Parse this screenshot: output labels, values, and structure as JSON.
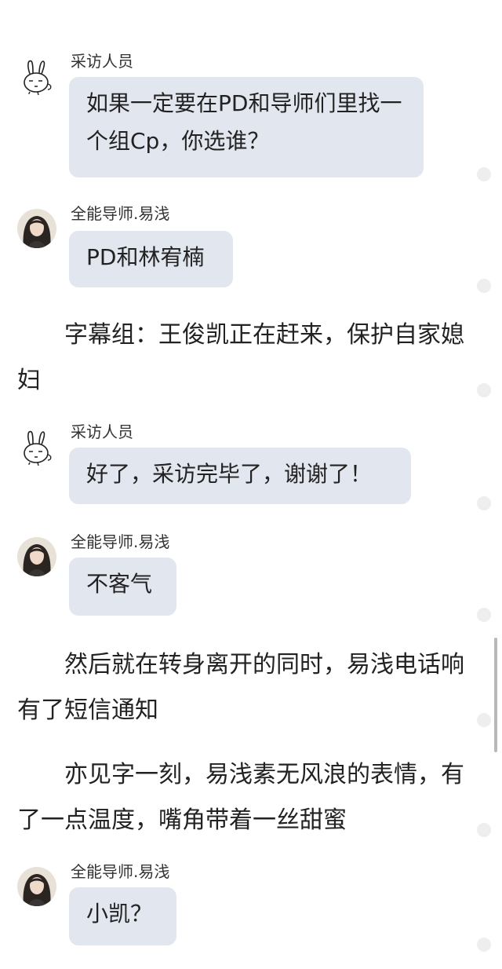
{
  "messages": [
    {
      "sender": "采访人员",
      "text": "如果一定要在PD和导师们里找一个组Cp，你选谁？",
      "avatar": "rabbit-icon"
    },
    {
      "sender": "全能导师.易浅",
      "text": "PD和林宥楠",
      "avatar": "girl-photo"
    },
    {
      "sender": "采访人员",
      "text": "好了，采访完毕了，谢谢了！",
      "avatar": "rabbit-icon"
    },
    {
      "sender": "全能导师.易浅",
      "text": "不客气",
      "avatar": "girl-photo"
    },
    {
      "sender": "全能导师.易浅",
      "text": "小凯？",
      "avatar": "girl-photo"
    }
  ],
  "narrations": [
    "字幕组：王俊凯正在赶来，保护自家媳妇",
    "然后就在转身离开的同时，易浅电话响有了短信通知",
    "亦见字一刻，易浅素无风浪的表情，有了一点温度，嘴角带着一丝甜蜜"
  ],
  "colors": {
    "bubble": "#e2e6ef",
    "text": "#222222",
    "dot": "#eeeeee",
    "scrollbar": "#b9b9b9"
  }
}
